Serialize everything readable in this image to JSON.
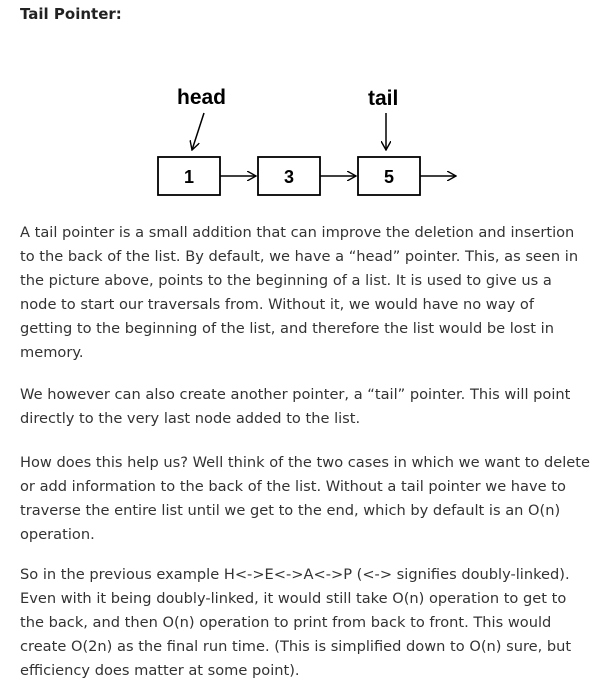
{
  "heading": "Tail Pointer:",
  "diagram": {
    "head_label": "head",
    "tail_label": "tail",
    "nodes": [
      "1",
      "3",
      "5"
    ]
  },
  "paragraphs": [
    "A tail pointer is a small addition that can improve the deletion and insertion to the back of the list. By default, we have a “head” pointer. This, as seen in the picture above, points to the beginning of a list. It is used to give us a node to start our traversals from. Without it, we would have no way of getting to the beginning of the list, and therefore the list would be lost in memory.",
    "We however can also create another pointer, a “tail” pointer. This will point directly to the very last node added to the list.",
    "How does this help us? Well think of the two cases in which we want to delete or add information to the back of the list. Without a tail pointer we have to traverse the entire list until we get to the end, which by default is an O(n) operation.",
    "So in the previous example H<->E<->A<->P (<-> signifies doubly-linked). Even with it being doubly-linked, it would still take O(n) operation to get to the back, and then O(n) operation to print from back to front. This would create O(2n) as the final run time. (This is simplified down to O(n) sure, but efficiency does matter at some point)."
  ]
}
